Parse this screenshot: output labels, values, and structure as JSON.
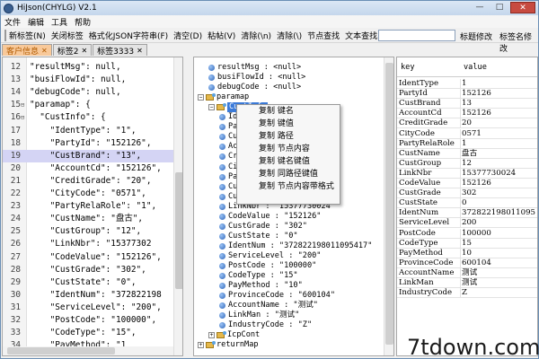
{
  "window": {
    "title": "HiJson(CHYLG) V2.1",
    "controls": [
      "—",
      "□",
      "✕"
    ]
  },
  "menu": [
    "文件",
    "编辑",
    "工具",
    "帮助"
  ],
  "toolbar": {
    "buttons": [
      "新标签(N)",
      "关闭标签",
      "格式化JSON字符串(F)",
      "清空(D)",
      "粘帖(V)",
      "清除(\\n)",
      "清除(\\)",
      "节点查找",
      "文本查找"
    ],
    "search_value": "",
    "right_buttons": [
      "标题修改",
      "标签名修改"
    ]
  },
  "tabs": [
    {
      "label": "客户信息",
      "active": true
    },
    {
      "label": "标签2",
      "active": false
    },
    {
      "label": "标签3333",
      "active": false
    }
  ],
  "editor": {
    "lines": [
      {
        "n": "12",
        "fold": "",
        "text": "\"resultMsg\": null,"
      },
      {
        "n": "13",
        "fold": "",
        "text": "\"busiFlowId\": null,"
      },
      {
        "n": "14",
        "fold": "",
        "text": "\"debugCode\": null,"
      },
      {
        "n": "15",
        "fold": "⊟",
        "text": "\"paramap\": {"
      },
      {
        "n": "16",
        "fold": "⊟",
        "text": "  \"CustInfo\": {"
      },
      {
        "n": "17",
        "fold": "",
        "text": "    \"IdentType\": \"1\","
      },
      {
        "n": "18",
        "fold": "",
        "text": "    \"PartyId\": \"152126\","
      },
      {
        "n": "19",
        "fold": "",
        "text": "    \"CustBrand\": \"13\","
      },
      {
        "n": "20",
        "fold": "",
        "text": "    \"AccountCd\": \"152126\","
      },
      {
        "n": "21",
        "fold": "",
        "text": "    \"CreditGrade\": \"20\","
      },
      {
        "n": "22",
        "fold": "",
        "text": "    \"CityCode\": \"0571\","
      },
      {
        "n": "23",
        "fold": "",
        "text": "    \"PartyRelaRole\": \"1\","
      },
      {
        "n": "24",
        "fold": "",
        "text": "    \"CustName\": \"盘古\","
      },
      {
        "n": "25",
        "fold": "",
        "text": "    \"CustGroup\": \"12\","
      },
      {
        "n": "26",
        "fold": "",
        "text": "    \"LinkNbr\": \"15377302"
      },
      {
        "n": "27",
        "fold": "",
        "text": "    \"CodeValue\": \"152126\","
      },
      {
        "n": "28",
        "fold": "",
        "text": "    \"CustGrade\": \"302\","
      },
      {
        "n": "29",
        "fold": "",
        "text": "    \"CustState\": \"0\","
      },
      {
        "n": "30",
        "fold": "",
        "text": "    \"IdentNum\": \"372822198"
      },
      {
        "n": "31",
        "fold": "",
        "text": "    \"ServiceLevel\": \"200\","
      },
      {
        "n": "32",
        "fold": "",
        "text": "    \"PostCode\": \"100000\","
      },
      {
        "n": "33",
        "fold": "",
        "text": "    \"CodeType\": \"15\","
      },
      {
        "n": "34",
        "fold": "",
        "text": "    \"PayMethod\": \"1"
      }
    ],
    "highlight_line": "19"
  },
  "tree": {
    "nodes": [
      {
        "text": "resultMsg : <null>",
        "type": "leaf",
        "depth": 1
      },
      {
        "text": "busiFlowId : <null>",
        "type": "leaf",
        "depth": 1
      },
      {
        "text": "debugCode : <null>",
        "type": "leaf",
        "depth": 1
      },
      {
        "text": "paramap",
        "type": "folder",
        "depth": 0,
        "exp": "−"
      },
      {
        "text": "CustInfo",
        "type": "folder",
        "depth": 1,
        "exp": "−",
        "selected": true
      },
      {
        "text": "IdentType : \"1\"",
        "type": "leaf",
        "depth": 2
      },
      {
        "text": "PartyId : \"152126\"",
        "type": "leaf",
        "depth": 2
      },
      {
        "text": "CustBrand : \"13\"",
        "type": "leaf",
        "depth": 2
      },
      {
        "text": "AccountCd : \"152126\"",
        "type": "leaf",
        "depth": 2
      },
      {
        "text": "CreditGrade : \"20\"",
        "type": "leaf",
        "depth": 2
      },
      {
        "text": "CityCode : \"0571\"",
        "type": "leaf",
        "depth": 2
      },
      {
        "text": "PartyRelaRole : \"1\"",
        "type": "leaf",
        "depth": 2
      },
      {
        "text": "CustName : \"盘古\"",
        "type": "leaf",
        "depth": 2
      },
      {
        "text": "CustGroup : \"12\"",
        "type": "leaf",
        "depth": 2
      },
      {
        "text": "LinkNbr : \"15377730024\"",
        "type": "leaf",
        "depth": 2
      },
      {
        "text": "CodeValue : \"152126\"",
        "type": "leaf",
        "depth": 2
      },
      {
        "text": "CustGrade : \"302\"",
        "type": "leaf",
        "depth": 2
      },
      {
        "text": "CustState : \"0\"",
        "type": "leaf",
        "depth": 2
      },
      {
        "text": "IdentNum : \"372822198011095417\"",
        "type": "leaf",
        "depth": 2
      },
      {
        "text": "ServiceLevel : \"200\"",
        "type": "leaf",
        "depth": 2
      },
      {
        "text": "PostCode : \"100000\"",
        "type": "leaf",
        "depth": 2
      },
      {
        "text": "CodeType : \"15\"",
        "type": "leaf",
        "depth": 2
      },
      {
        "text": "PayMethod : \"10\"",
        "type": "leaf",
        "depth": 2
      },
      {
        "text": "ProvinceCode : \"600104\"",
        "type": "leaf",
        "depth": 2
      },
      {
        "text": "AccountName : \"测试\"",
        "type": "leaf",
        "depth": 2
      },
      {
        "text": "LinkMan : \"测试\"",
        "type": "leaf",
        "depth": 2
      },
      {
        "text": "IndustryCode : \"Z\"",
        "type": "leaf",
        "depth": 2
      },
      {
        "text": "IcpCont",
        "type": "folder",
        "depth": 1,
        "exp": "+"
      },
      {
        "text": "returnMap",
        "type": "folder",
        "depth": 0,
        "exp": "+"
      }
    ]
  },
  "context_menu": [
    "复制 键名",
    "复制 键值",
    "复制 路径",
    "复制 节点内容",
    "复制 键名键值",
    "复制 同路径键值",
    "复制 节点内容带格式"
  ],
  "table": {
    "headers": [
      "key",
      "value"
    ],
    "rows": [
      [
        "IdentType",
        "1"
      ],
      [
        "PartyId",
        "152126"
      ],
      [
        "CustBrand",
        "13"
      ],
      [
        "AccountCd",
        "152126"
      ],
      [
        "CreditGrade",
        "20"
      ],
      [
        "CityCode",
        "0571"
      ],
      [
        "PartyRelaRole",
        "1"
      ],
      [
        "CustName",
        "盘古"
      ],
      [
        "CustGroup",
        "12"
      ],
      [
        "LinkNbr",
        "15377730024"
      ],
      [
        "CodeValue",
        "152126"
      ],
      [
        "CustGrade",
        "302"
      ],
      [
        "CustState",
        "0"
      ],
      [
        "IdentNum",
        "372822198011095417"
      ],
      [
        "ServiceLevel",
        "200"
      ],
      [
        "PostCode",
        "100000"
      ],
      [
        "CodeType",
        "15"
      ],
      [
        "PayMethod",
        "10"
      ],
      [
        "ProvinceCode",
        "600104"
      ],
      [
        "AccountName",
        "测试"
      ],
      [
        "LinkMan",
        "测试"
      ],
      [
        "IndustryCode",
        "Z"
      ]
    ]
  },
  "watermark": "7tdown.com"
}
